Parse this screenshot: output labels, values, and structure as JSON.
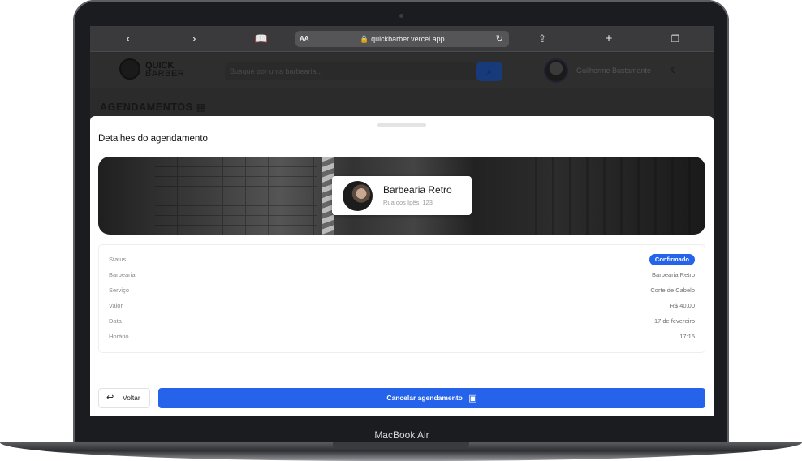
{
  "device": {
    "brand_label": "MacBook Air"
  },
  "browser": {
    "text_size_label": "AA",
    "url": "quickbarber.vercel.app",
    "icons": [
      "back-chevron-icon",
      "forward-chevron-icon",
      "bookmarks-icon",
      "lock-icon",
      "reload-icon",
      "share-icon",
      "new-tab-icon",
      "tabs-icon"
    ]
  },
  "app": {
    "logo": {
      "line1": "QUICK",
      "line2": "BARBER"
    },
    "search_placeholder": "Busque por uma barbearia...",
    "user_name": "Guilherme Bustamante",
    "page_heading": "AGENDAMENTOS"
  },
  "sheet": {
    "title": "Detalhes do agendamento",
    "shop": {
      "name": "Barbearia Retro",
      "address": "Rua dos Ipês, 123"
    },
    "details": [
      {
        "label": "Status",
        "value": "Confirmado"
      },
      {
        "label": "Barbearia",
        "value": "Barbearia Retro"
      },
      {
        "label": "Serviço",
        "value": "Corte de Cabelo"
      },
      {
        "label": "Valor",
        "value": "R$ 40,00"
      },
      {
        "label": "Data",
        "value": "17 de fevereiro"
      },
      {
        "label": "Horário",
        "value": "17:15"
      }
    ],
    "back_label": "Voltar",
    "cancel_label": "Cancelar agendamento"
  },
  "colors": {
    "primary": "#2563eb",
    "dim_overlay": "#2b2b2b",
    "surface": "#ffffff"
  }
}
